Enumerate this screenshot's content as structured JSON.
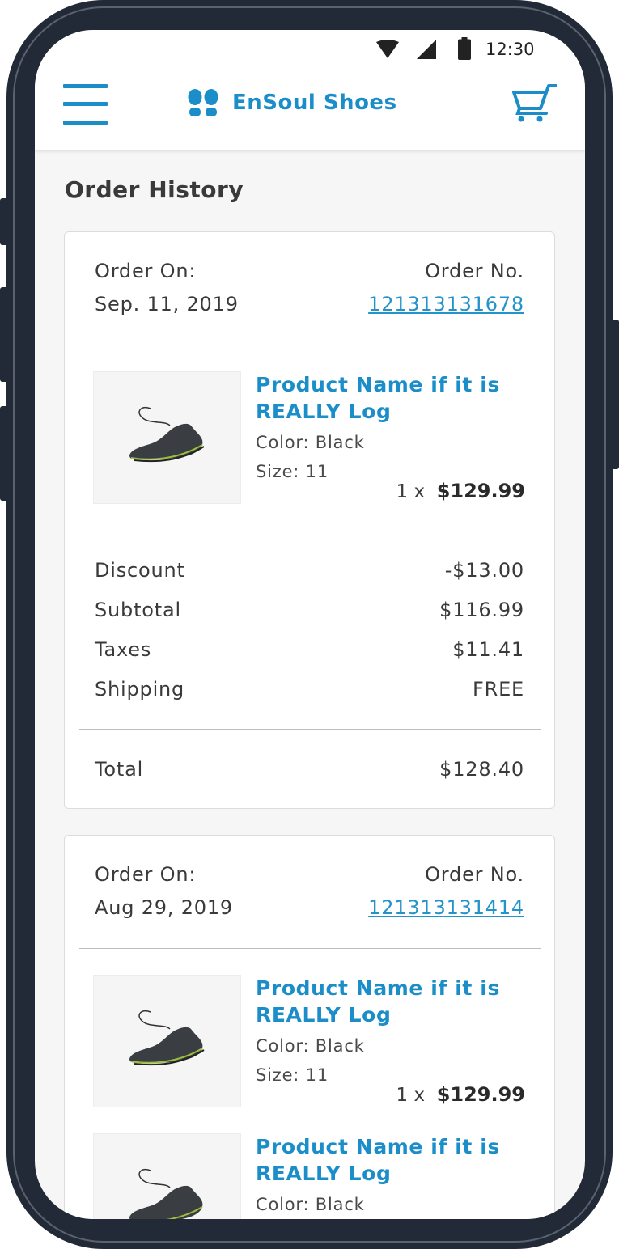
{
  "status_bar": {
    "time": "12:30",
    "icons": [
      "wifi-icon",
      "signal-icon",
      "battery-icon"
    ]
  },
  "app_bar": {
    "brand": "EnSoul Shoes",
    "menu_icon": "hamburger-menu-icon",
    "cart_icon": "shopping-cart-icon",
    "logo_icon": "footprints-logo-icon"
  },
  "page": {
    "title": "Order History"
  },
  "orders": [
    {
      "order_on_label": "Order On:",
      "date": "Sep. 11, 2019",
      "order_no_label": "Order No.",
      "order_no": "121313131678",
      "items": [
        {
          "name": "Product Name if it is REALLY Log",
          "color": "Color: Black",
          "size": "Size: 11",
          "qty": "1 x",
          "price": "$129.99"
        }
      ],
      "summary": [
        {
          "label": "Discount",
          "value": "-$13.00"
        },
        {
          "label": "Subtotal",
          "value": "$116.99"
        },
        {
          "label": "Taxes",
          "value": "$11.41"
        },
        {
          "label": "Shipping",
          "value": "FREE"
        }
      ],
      "total_label": "Total",
      "total": "$128.40"
    },
    {
      "order_on_label": "Order On:",
      "date": "Aug 29, 2019",
      "order_no_label": "Order No.",
      "order_no": "121313131414",
      "items": [
        {
          "name": "Product Name if it is REALLY Log",
          "color": "Color: Black",
          "size": "Size: 11",
          "qty": "1 x",
          "price": "$129.99"
        },
        {
          "name": "Product Name if it is REALLY Log",
          "color": "Color: Black"
        }
      ]
    }
  ],
  "colors": {
    "accent": "#1b8dc9",
    "link": "#2493cc",
    "frame": "#232a37",
    "background": "#f6f6f6"
  }
}
